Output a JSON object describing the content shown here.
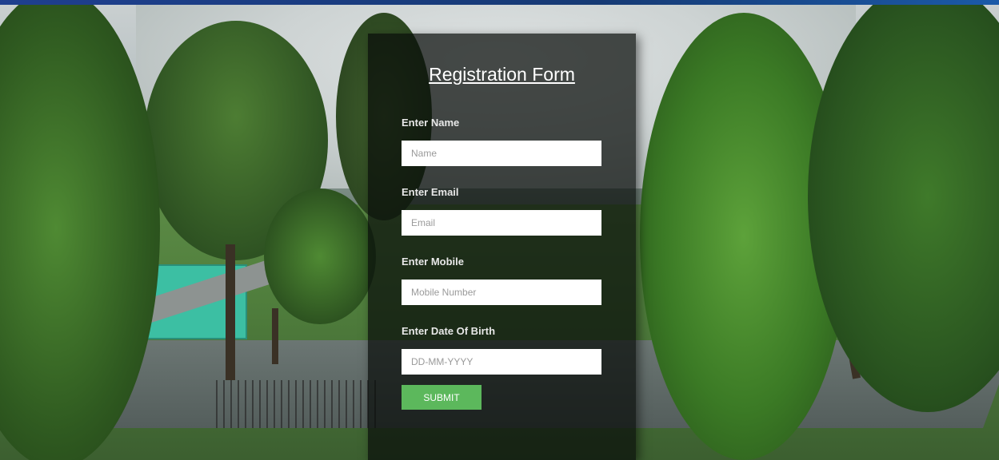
{
  "form": {
    "title": "Registration Form",
    "fields": [
      {
        "label": "Enter Name",
        "placeholder": "Name",
        "value": ""
      },
      {
        "label": "Enter Email",
        "placeholder": "Email",
        "value": ""
      },
      {
        "label": "Enter Mobile",
        "placeholder": "Mobile Number",
        "value": ""
      },
      {
        "label": "Enter Date Of Birth",
        "placeholder": "DD-MM-YYYY",
        "value": ""
      }
    ],
    "submit_label": "SUBMIT"
  },
  "colors": {
    "submit_button": "#5cb85c",
    "top_bar": "#1f3f8f",
    "panel_background": "#080c0a"
  }
}
